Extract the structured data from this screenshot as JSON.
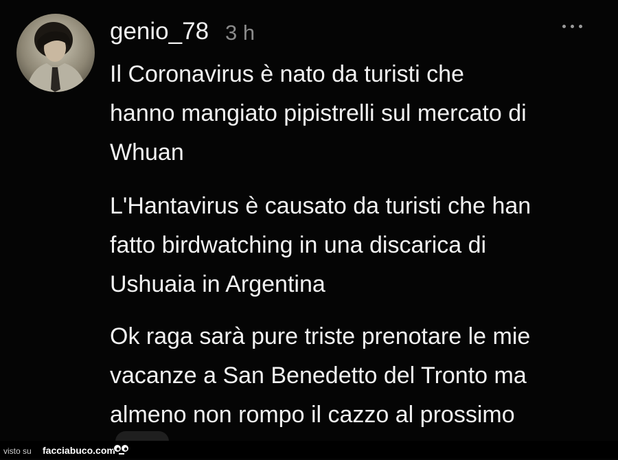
{
  "post": {
    "username": "genio_78",
    "time": "3 h",
    "more_icon": "more-horizontal-icon",
    "paragraphs": [
      [
        "Il Coronavirus è nato da turisti che",
        "hanno mangiato pipistrelli sul mercato di",
        "Whuan"
      ],
      [
        "L'Hantavirus è causato da turisti che han",
        "fatto birdwatching in una discarica di",
        "Ushuaia in Argentina"
      ],
      [
        "Ok raga sarà pure triste prenotare le mie",
        "vacanze a San Benedetto del Tronto ma",
        "almeno non rompo il cazzo al prossimo"
      ]
    ]
  },
  "watermark": {
    "prefix": "visto su",
    "site": "facciabuco.com",
    "logo_icon": "eyes-logo-icon"
  },
  "colors": {
    "background": "#050505",
    "text": "#f2f2f2",
    "muted": "#8a8a8a"
  }
}
